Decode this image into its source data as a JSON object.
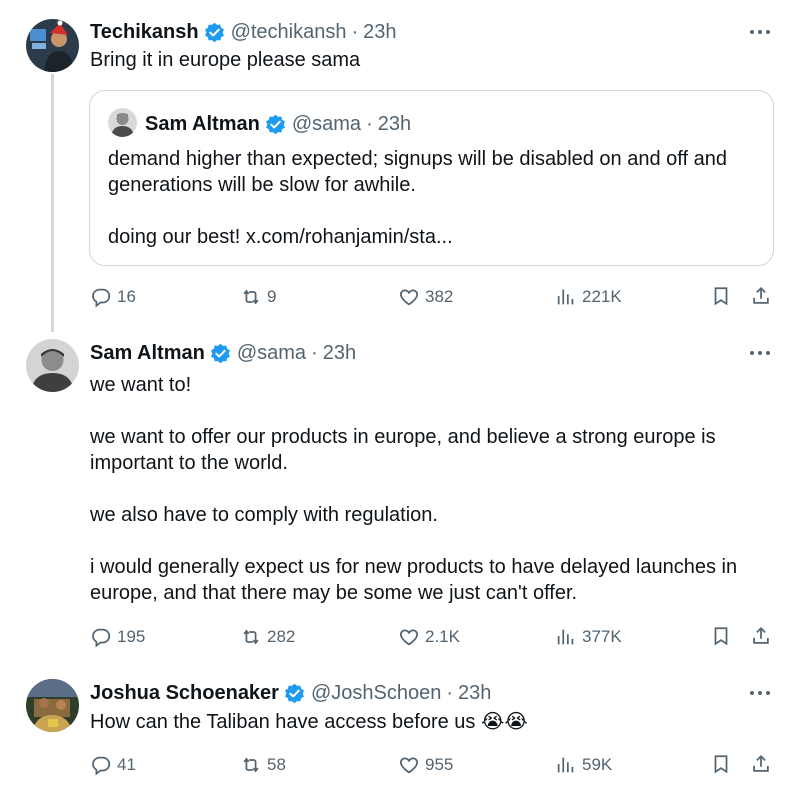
{
  "tweets": [
    {
      "name": "Techikansh",
      "handle": "@techikansh",
      "separator": "·",
      "time": "23h",
      "text": "Bring it in europe please sama",
      "quote": {
        "name": "Sam Altman",
        "handle": "@sama",
        "separator": "·",
        "time": "23h",
        "text": "demand higher than expected; signups will be disabled on and off and generations will be slow for awhile.\n\ndoing our best! x.com/rohanjamin/sta..."
      },
      "stats": {
        "replies": "16",
        "reposts": "9",
        "likes": "382",
        "views": "221K"
      }
    },
    {
      "name": "Sam Altman",
      "handle": "@sama",
      "separator": "·",
      "time": "23h",
      "text": "we want to!\n\nwe want to offer our products in europe, and believe a strong europe is important to the world.\n\nwe also have to comply with regulation.\n\ni would generally expect us for new products to have delayed launches in europe, and that there may be some we just can't offer.",
      "stats": {
        "replies": "195",
        "reposts": "282",
        "likes": "2.1K",
        "views": "377K"
      }
    },
    {
      "name": "Joshua Schoenaker",
      "handle": "@JoshSchoen",
      "separator": "·",
      "time": "23h",
      "text": "How can the Taliban have access before us 😭😭",
      "stats": {
        "replies": "41",
        "reposts": "58",
        "likes": "955",
        "views": "59K"
      }
    }
  ],
  "icons": {
    "verified": "verified-badge-icon",
    "more": "more-icon",
    "reply": "reply-icon",
    "repost": "repost-icon",
    "like": "heart-icon",
    "views": "views-icon",
    "bookmark": "bookmark-icon",
    "share": "share-icon"
  },
  "colors": {
    "text": "#0f1419",
    "secondary": "#536471",
    "verified": "#1d9bf0",
    "border": "#cfd9de"
  }
}
